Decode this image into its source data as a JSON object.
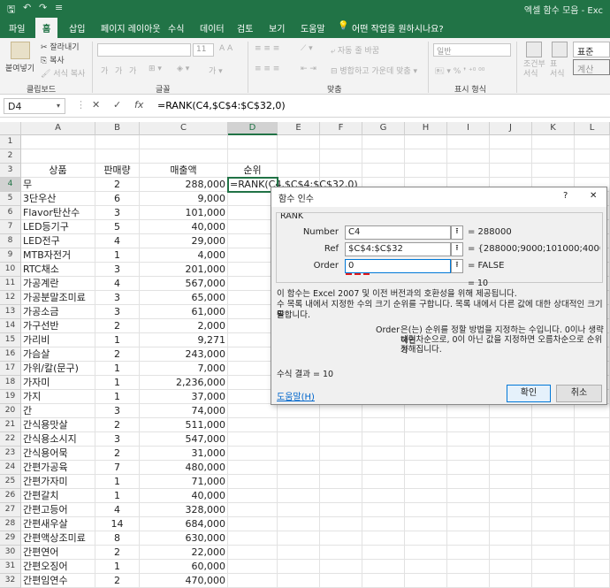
{
  "app": {
    "title": "엑셀 함수 모음 - Exc",
    "quick_access": [
      "🖫",
      "↶",
      "↷",
      "≡"
    ]
  },
  "tabs": [
    "파일",
    "홈",
    "삽입",
    "페이지 레이아웃",
    "수식",
    "데이터",
    "검토",
    "보기",
    "도움말",
    "어떤 작업을 원하시나요?"
  ],
  "ribbon": {
    "paste": "붙여넣기",
    "cut": "잘라내기",
    "copy": "복사",
    "format_painter": "서식 복사",
    "clipboard_group": "클립보드",
    "font_group": "글꼴",
    "font_size": "11",
    "bold": "가",
    "italic": "가",
    "underline": "가",
    "wrap_text": "자동 줄 바꿈",
    "merge_center": "병합하고 가운데 맞춤",
    "align_group": "맞춤",
    "number_format": "일반",
    "number_group": "표시 형식",
    "cond_format": "조건부\n서식",
    "table_format": "표\n서식",
    "style_normal": "표준",
    "style_calc": "계산"
  },
  "formula_bar": {
    "name_box": "D4",
    "cancel": "✕",
    "enter": "✓",
    "fx": "fx",
    "formula": "=RANK(C4,$C$4:$C$32,0)"
  },
  "grid": {
    "columns": [
      "A",
      "B",
      "C",
      "D",
      "E",
      "F",
      "G",
      "H",
      "I",
      "J",
      "K",
      "L"
    ],
    "header_row": [
      "상품",
      "판매량",
      "매출액",
      "순위"
    ],
    "active_cell_text": "=RANK(C4,$C$4:$C$32,0)",
    "rows": [
      [
        "무",
        "2",
        "288,000"
      ],
      [
        "3단우산",
        "6",
        "9,000"
      ],
      [
        "Flavor탄산수",
        "3",
        "101,000"
      ],
      [
        "LED등기구",
        "5",
        "40,000"
      ],
      [
        "LED전구",
        "4",
        "29,000"
      ],
      [
        "MTB자전거",
        "1",
        "4,000"
      ],
      [
        "RTC채소",
        "3",
        "201,000"
      ],
      [
        "가공계란",
        "4",
        "567,000"
      ],
      [
        "가공분말조미료",
        "3",
        "65,000"
      ],
      [
        "가공소금",
        "3",
        "61,000"
      ],
      [
        "가구선반",
        "2",
        "2,000"
      ],
      [
        "가리비",
        "1",
        "9,271"
      ],
      [
        "가슴살",
        "2",
        "243,000"
      ],
      [
        "가위/칼(문구)",
        "1",
        "7,000"
      ],
      [
        "가자미",
        "1",
        "2,236,000"
      ],
      [
        "가지",
        "1",
        "37,000"
      ],
      [
        "간",
        "3",
        "74,000"
      ],
      [
        "간식용맛살",
        "2",
        "511,000"
      ],
      [
        "간식용소시지",
        "3",
        "547,000"
      ],
      [
        "간식용어묵",
        "2",
        "31,000"
      ],
      [
        "간편가공육",
        "7",
        "480,000"
      ],
      [
        "간편가자미",
        "1",
        "71,000"
      ],
      [
        "간편갈치",
        "1",
        "40,000"
      ],
      [
        "간편고등어",
        "4",
        "328,000"
      ],
      [
        "간편새우살",
        "14",
        "684,000"
      ],
      [
        "간편액상조미료",
        "8",
        "630,000"
      ],
      [
        "간편연어",
        "2",
        "22,000"
      ],
      [
        "간편오징어",
        "1",
        "60,000"
      ],
      [
        "간편임연수",
        "2",
        "470,000"
      ]
    ]
  },
  "dialog": {
    "title": "함수 인수",
    "help": "?",
    "close": "✕",
    "function_name": "RANK",
    "args": [
      {
        "label": "Number",
        "value": "C4",
        "result": "= 288000"
      },
      {
        "label": "Ref",
        "value": "$C$4:$C$32",
        "result": "= {288000;9000;101000;40000;29000"
      },
      {
        "label": "Order",
        "value": "0",
        "result": "= FALSE"
      }
    ],
    "total_result": "= 10",
    "desc1": "이 함수는 Excel 2007 및 이전 버전과의 호환성을 위해 제공됩니다.",
    "desc2": "수 목록 내에서 지정한 수의 크기 순위를 구합니다. 목록 내에서 다른 값에 대한 상대적인 크기를",
    "desc3": "말합니다.",
    "order_label": "Order",
    "order_desc1": "은(는) 순위를 정할 방법을 지정하는 수입니다. 0이나 생략하면",
    "order_desc2": "내림차순으로, 0이 아닌 값을 지정하면 오름차순으로 순위가",
    "order_desc3": "정해집니다.",
    "formula_result": "수식 결과 =  10",
    "help_link": "도움말(H)",
    "ok": "확인",
    "cancel": "취소"
  }
}
